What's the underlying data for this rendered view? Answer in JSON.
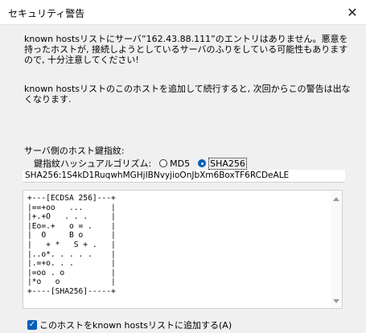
{
  "window": {
    "title": "セキュリティ警告",
    "close_glyph": "✕"
  },
  "message": {
    "line1": "known hostsリストにサーバ”162.43.88.111”のエントリはありません。悪意を持ったホストが, 接続しようとしているサーバのふりをしている可能性もありますので, 十分注意してください!",
    "line2": "known hostsリストのこのホストを追加して続行すると, 次回からこの警告は出なくなります."
  },
  "fingerprint": {
    "label": "サーバ側のホスト鍵指紋:",
    "algo_label": "鍵指紋ハッシュアルゴリズム:",
    "options": [
      {
        "label": "MD5",
        "checked": false
      },
      {
        "label": "SHA256",
        "checked": true
      }
    ],
    "value": "SHA256:1S4kD1RuqwhMGHjIBNvyjioOnJbXm6BoxTF6RCDeALE",
    "randomart": "+---[ECDSA 256]---+\n|==+oo   ...      |\n|+.+O   . . .     |\n|Eo=.+   o = .    |\n|  O     B o      |\n|   + *   S + .   |\n|..o*. . . . .    |\n|.=+o. . .        |\n|=oo . o          |\n|*o   o           |\n+----[SHA256]-----+"
  },
  "add_to_known_hosts": {
    "checked": true,
    "label": "このホストをknown hostsリストに追加する(A)"
  }
}
